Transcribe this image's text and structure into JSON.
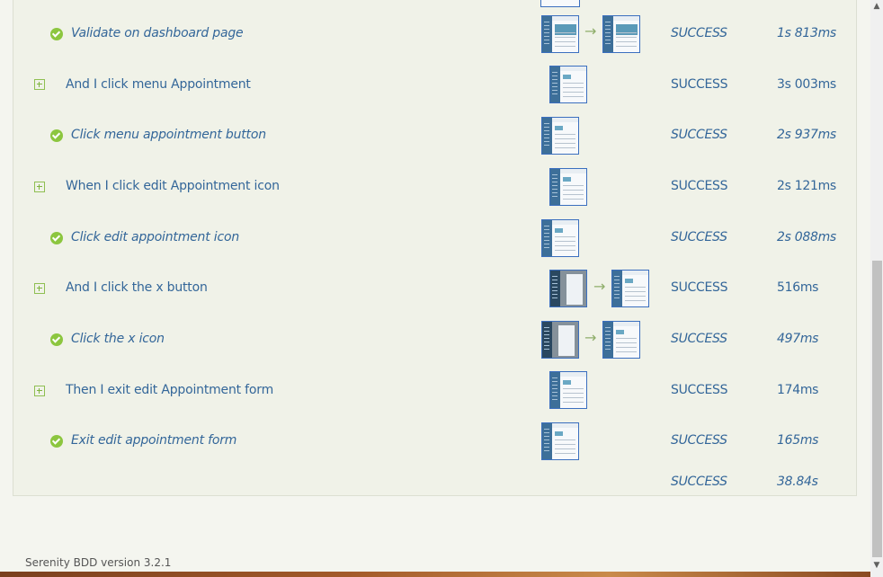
{
  "rows": [
    {
      "kind": "sub",
      "description": "Validate on dashboard page",
      "result": "SUCCESS",
      "duration": "1s 813ms"
    },
    {
      "kind": "step",
      "description": "And I click menu Appointment",
      "result": "SUCCESS",
      "duration": "3s 003ms"
    },
    {
      "kind": "sub",
      "description": "Click menu appointment button",
      "result": "SUCCESS",
      "duration": "2s 937ms"
    },
    {
      "kind": "step",
      "description": "When I click edit Appointment icon",
      "result": "SUCCESS",
      "duration": "2s 121ms"
    },
    {
      "kind": "sub",
      "description": "Click edit appointment icon",
      "result": "SUCCESS",
      "duration": "2s 088ms"
    },
    {
      "kind": "step",
      "description": "And I click the x button",
      "result": "SUCCESS",
      "duration": "516ms"
    },
    {
      "kind": "sub",
      "description": "Click the x icon",
      "result": "SUCCESS",
      "duration": "497ms"
    },
    {
      "kind": "step",
      "description": "Then I exit edit Appointment form",
      "result": "SUCCESS",
      "duration": "174ms"
    },
    {
      "kind": "sub",
      "description": "Exit edit appointment form",
      "result": "SUCCESS",
      "duration": "165ms"
    }
  ],
  "total": {
    "result": "SUCCESS",
    "duration": "38.84s"
  },
  "footer": {
    "version": "Serenity BDD version 3.2.1"
  },
  "colors": {
    "link": "#336699",
    "success_icon": "#8cc63f",
    "panel": "#f0f2e8"
  },
  "icons": {
    "arrow": "→",
    "scroll_up": "▲",
    "scroll_down": "▼"
  }
}
